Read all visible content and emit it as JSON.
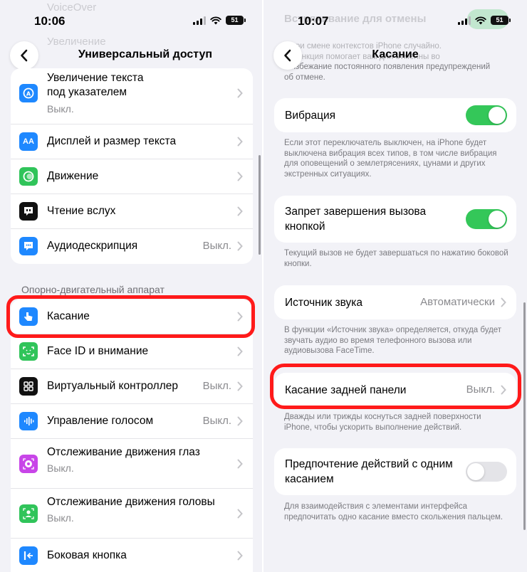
{
  "left": {
    "status": {
      "time": "10:06",
      "battery": "51"
    },
    "ghost_rows": [
      "VoiceOver",
      "Увеличение"
    ],
    "nav": {
      "title": "Универсальный доступ"
    },
    "group1": [
      {
        "label_line1": "Увеличение текста",
        "label_line2": "под указателем",
        "value": "Выкл.",
        "icon": "text-zoom-icon"
      },
      {
        "label": "Дисплей и размер текста",
        "icon": "text-size-icon"
      },
      {
        "label": "Движение",
        "icon": "motion-icon"
      },
      {
        "label": "Чтение вслух",
        "icon": "speech-icon"
      },
      {
        "label": "Аудиодескрипция",
        "value": "Выкл.",
        "icon": "audio-description-icon"
      }
    ],
    "section_header": "Опорно-двигательный аппарат",
    "group2": [
      {
        "label": "Касание",
        "icon": "touch-hand-icon"
      },
      {
        "label": "Face ID и внимание",
        "icon": "face-id-icon"
      },
      {
        "label": "Виртуальный контроллер",
        "value": "Выкл.",
        "icon": "switch-control-icon"
      },
      {
        "label": "Управление голосом",
        "value": "Выкл.",
        "icon": "voice-control-icon"
      },
      {
        "label": "Отслеживание движения глаз",
        "value": "Выкл.",
        "icon": "eye-tracking-icon"
      },
      {
        "label": "Отслеживание движения головы",
        "value": "Выкл.",
        "icon": "head-tracking-icon"
      },
      {
        "label": "Боковая кнопка",
        "icon": "side-button-icon"
      }
    ]
  },
  "right": {
    "status": {
      "time": "10:07",
      "battery": "51"
    },
    "ghost_top": "Встряхивание для отмены",
    "top_footer": [
      "...при смене контекстов iPhone случайно.",
      "...функция помогает вам для отменны во",
      "...избежание постоянного появления предупреждений",
      "об отмене."
    ],
    "nav": {
      "title": "Касание"
    },
    "vibration": {
      "label": "Вибрация",
      "on": true,
      "footer": "Если этот переключатель выключен, на iPhone будет выключена вибрация всех типов, в том числе вибрация для оповещений о землетрясениях, цунами и других экстренных ситуациях."
    },
    "lock_end_call": {
      "label_line1": "Запрет завершения вызова",
      "label_line2": "кнопкой",
      "on": true,
      "footer": "Текущий вызов не будет завершаться по нажатию боковой кнопки."
    },
    "audio_routing": {
      "label": "Источник звука",
      "value": "Автоматически",
      "footer": "В функции «Источник звука» определяется, откуда будет звучать аудио во время телефонного вызова или аудиовызова FaceTime."
    },
    "back_tap": {
      "label": "Касание задней панели",
      "value": "Выкл.",
      "footer": "Дважды или трижды коснуться задней поверхности iPhone, чтобы ускорить выполнение действий."
    },
    "prefer_single_touch": {
      "label_line1": "Предпочтение действий с одним",
      "label_line2": "касанием",
      "on": false,
      "footer": "Для взаимодействия с элементами интерфейса предпочитать одно касание вместо скольжения пальцем."
    }
  },
  "colors": {
    "accent_green": "#34c759",
    "highlight_red": "#ff1a1a",
    "background": "#f2f2f7"
  }
}
